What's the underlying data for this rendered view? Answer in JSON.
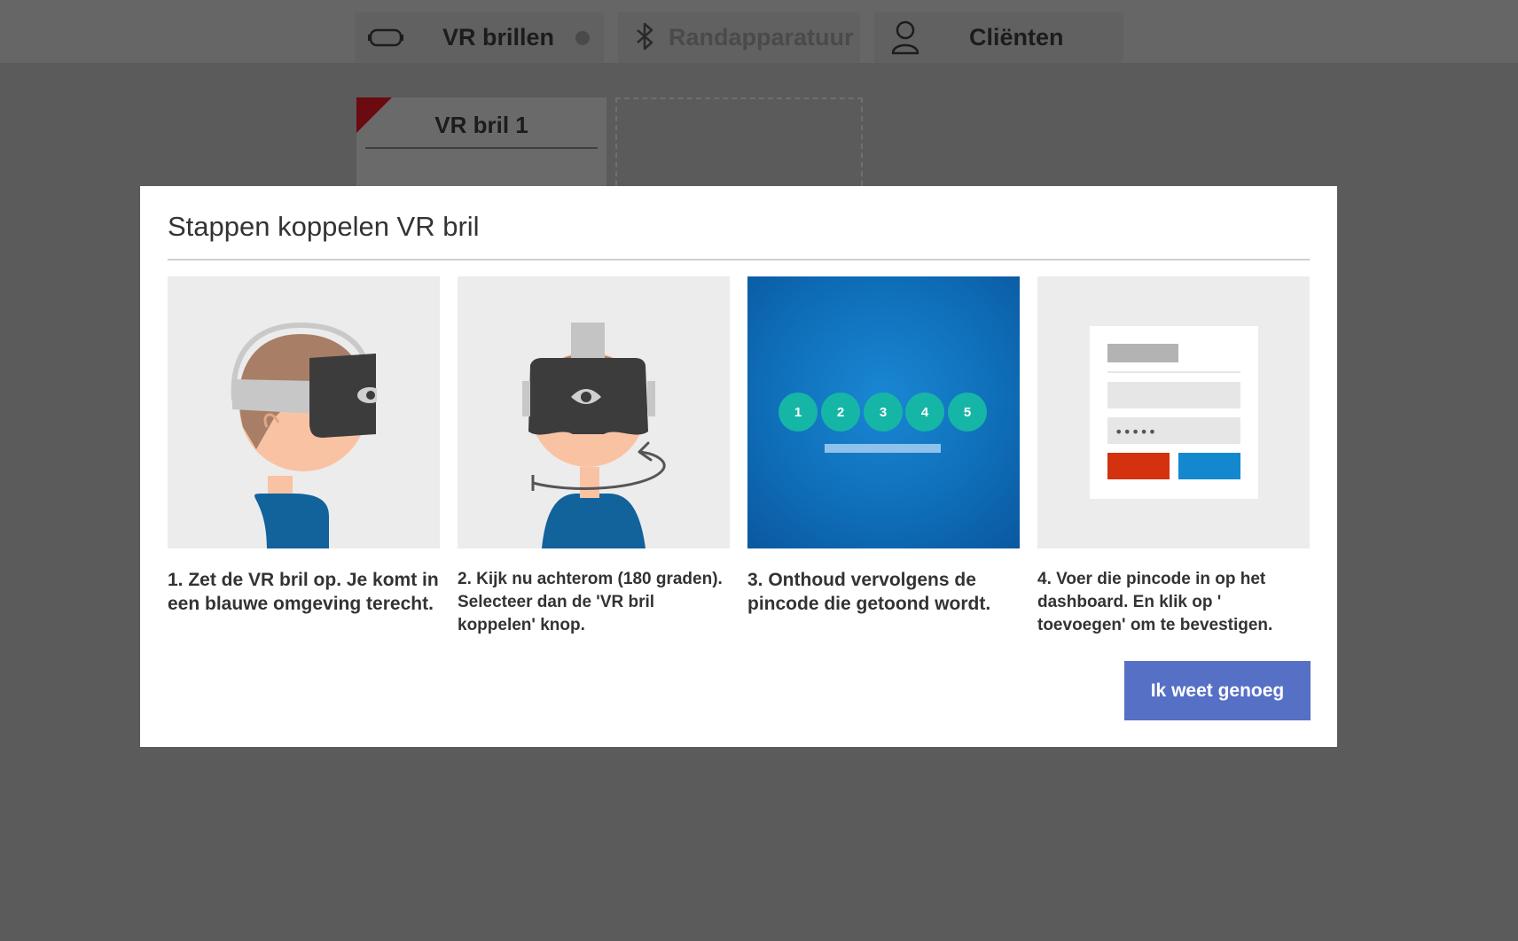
{
  "topbar": {
    "tabs": [
      {
        "label": "VR brillen",
        "icon": "vr-headset-icon"
      },
      {
        "label": "Randapparatuur",
        "icon": "bluetooth-icon"
      },
      {
        "label": "Cliënten",
        "icon": "user-icon"
      }
    ]
  },
  "devices": [
    {
      "name": "VR bril 1"
    }
  ],
  "modal": {
    "title": "Stappen koppelen VR bril",
    "steps": [
      {
        "text": "1. Zet de VR bril op. Je komt in een blauwe omgeving terecht."
      },
      {
        "text": "2. Kijk nu achterom (180 graden). Selecteer dan de 'VR bril koppelen' knop."
      },
      {
        "text": "3. Onthoud vervolgens de pincode die getoond wordt.",
        "pin_digits": [
          "1",
          "2",
          "3",
          "4",
          "5"
        ]
      },
      {
        "text": "4. Voer die pincode in op het dashboard. En klik op ' toevoegen' om te bevestigen.",
        "password_mask": "•••••"
      }
    ],
    "confirm_label": "Ik weet genoeg"
  },
  "colors": {
    "accent": "#5670c6",
    "teal": "#16b6a6",
    "vr_blue": "#0f74c2",
    "cancel_red": "#d4310f",
    "confirm_blue": "#1488cf"
  }
}
